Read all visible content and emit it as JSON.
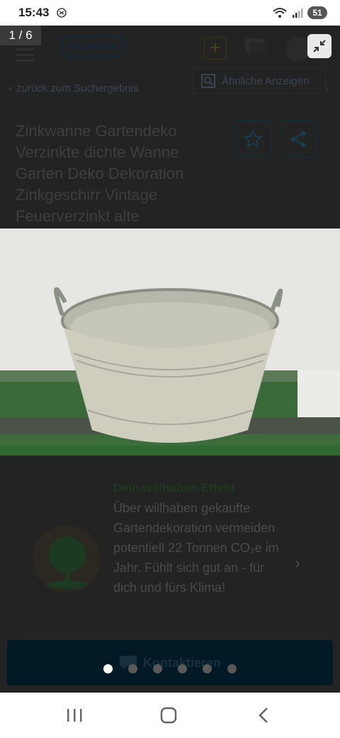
{
  "status_bar": {
    "time": "15:43",
    "battery": "51"
  },
  "viewer": {
    "counter": "1 / 6",
    "slide_count": 6,
    "active_slide": 1
  },
  "header": {
    "logo_text": "WILLHABEN"
  },
  "nav": {
    "back_link": "zurück zum Suchergebnis",
    "similar_ads": "Ähnliche Anzeigen"
  },
  "listing": {
    "title": "Zinkwanne Gartendeko Verzinkte dichte Wanne Garten Deko Dekoration Zinkgeschirr Vintage Feuerverzinkt alte"
  },
  "eco_card": {
    "title": "Dein willhaben Effekt",
    "body": "Über willhaben gekaufte Gartendekoration vermeiden potentiell 22 Tonnen CO₂e im Jahr. Fühlt sich gut an - für dich und fürs Klima!"
  },
  "contact_button": {
    "label": "Kontaktieren"
  },
  "icons": {
    "status": [
      "nfc-icon",
      "wifi-icon",
      "signal-icon"
    ],
    "header": [
      "menu-icon",
      "plus-icon",
      "chat-icon",
      "avatar"
    ],
    "actions": [
      "star-icon",
      "share-icon"
    ],
    "viewer": [
      "collapse-icon"
    ],
    "android_nav": [
      "recents-icon",
      "home-icon",
      "back-icon"
    ]
  },
  "colors": {
    "dim_overlay": "#232323",
    "accent_dark": "#021a26",
    "dot_active": "#ffffff",
    "dot_inactive": "#595959"
  }
}
